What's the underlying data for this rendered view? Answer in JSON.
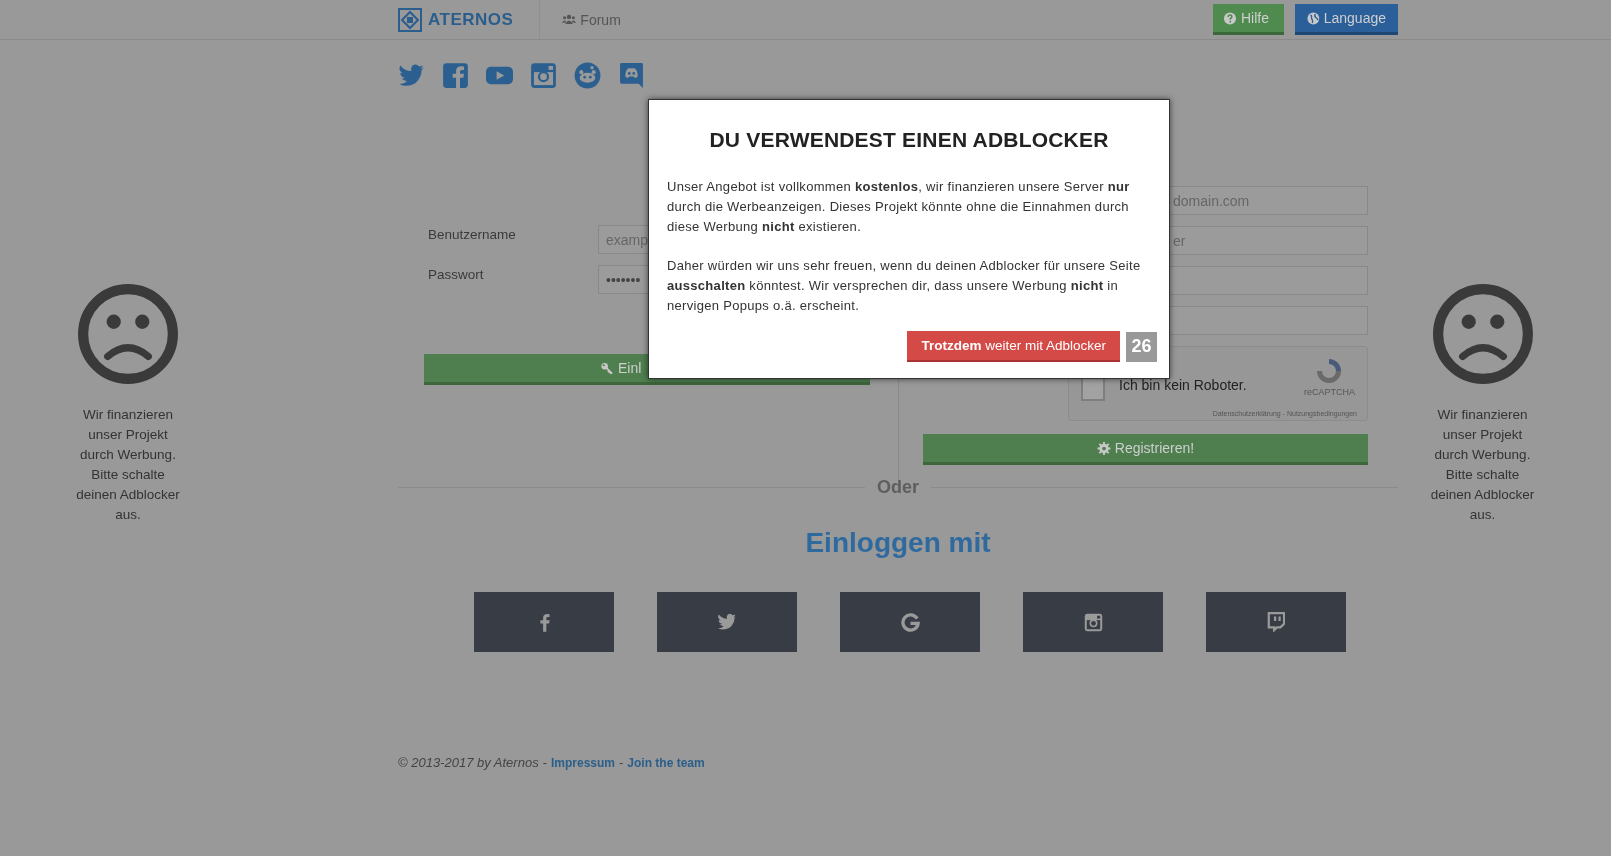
{
  "header": {
    "logo": "ATERNOS",
    "nav": [
      {
        "label": "Forum"
      }
    ],
    "buttons": [
      {
        "label": "Hilfe",
        "kind": "help"
      },
      {
        "label": "Language",
        "kind": "language"
      }
    ]
  },
  "login_form": {
    "fields": [
      {
        "label": "Benutzername",
        "placeholder": "examp"
      },
      {
        "label": "Passwort",
        "value": "•••••••"
      }
    ],
    "button": "Einl"
  },
  "register_form": {
    "fields": [
      {
        "placeholder": "domain.com"
      },
      {
        "placeholder": "er"
      }
    ],
    "captcha": {
      "label": "Ich bin kein Roboter.",
      "checked": false,
      "brand": "reCAPTCHA",
      "links": "Datenschutzerklärung - Nutzungsbedingungen"
    },
    "button": "Registrieren!"
  },
  "divider": "Oder",
  "social_login": {
    "title": "Einloggen mit"
  },
  "side_notes": [
    {
      "lines": [
        "Wir finanzieren",
        "unser Projekt",
        "durch Werbung.",
        "Bitte schalte",
        "deinen Adblocker",
        "aus."
      ]
    },
    {
      "lines": [
        "Wir finanzieren",
        "unser Projekt",
        "durch Werbung.",
        "Bitte schalte",
        "deinen Adblocker",
        "aus."
      ]
    }
  ],
  "footer": {
    "copyright": "© 2013-2017 by Aternos",
    "links": [
      {
        "sep": "-",
        "label": "Impressum"
      },
      {
        "sep": "-",
        "label": "Join the team"
      }
    ]
  },
  "modal": {
    "title": "DU VERWENDEST EINEN ADBLOCKER",
    "paragraphs": [
      "Unser Angebot ist vollkommen **kostenlos**, wir finanzieren unsere Server **nur** durch die Werbeanzeigen. Dieses Projekt könnte ohne die Einnahmen durch diese Werbung **nicht** existieren.",
      "Daher würden wir uns sehr freuen, wenn du deinen Adblocker für unsere Seite **ausschalten** könntest. Wir versprechen dir, dass unsere Werbung **nicht** in nervigen Popups o.ä. erscheint."
    ],
    "button": "**Trotzdem** weiter mit Adblocker",
    "countdown": "26"
  }
}
